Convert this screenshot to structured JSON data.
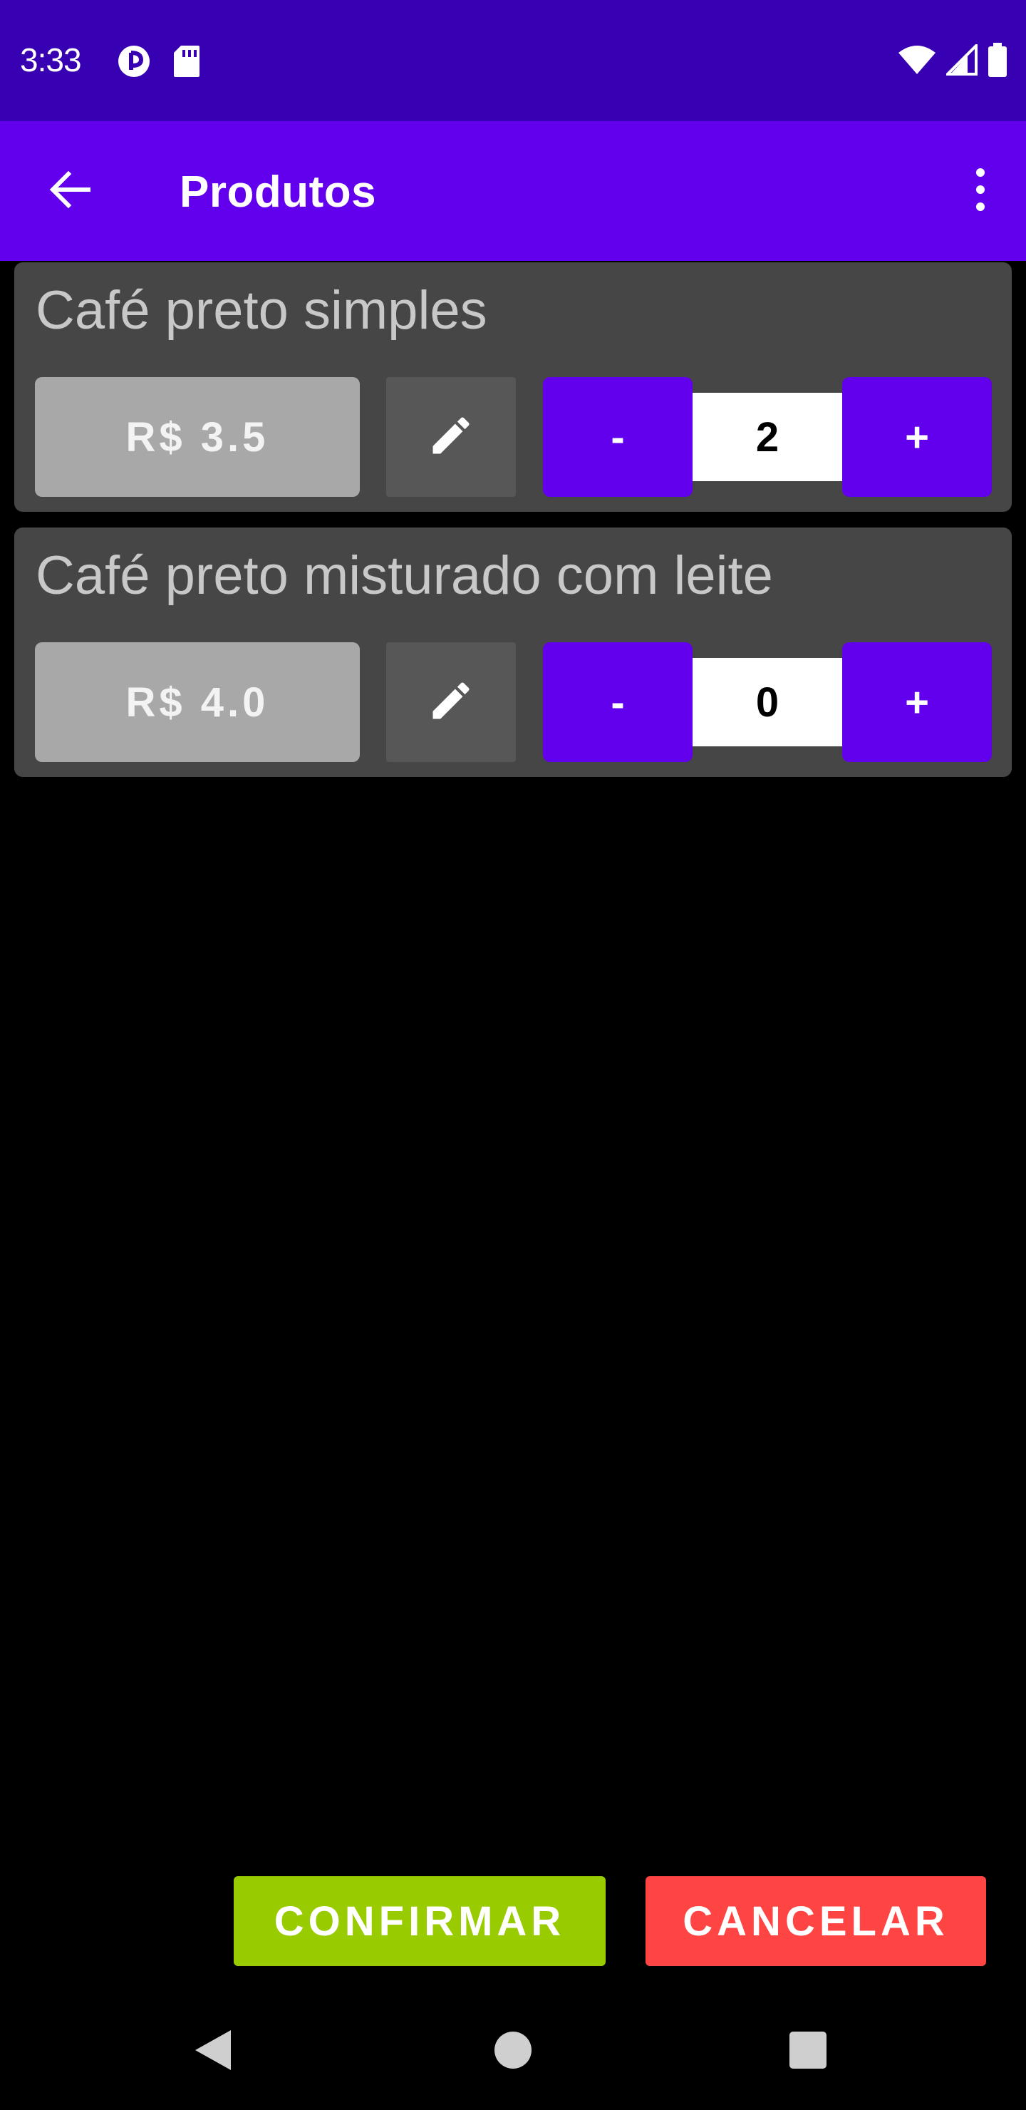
{
  "status_bar": {
    "time": "3:33",
    "icons_left": [
      "notification-app-icon",
      "sd-card-icon"
    ],
    "icons_right": [
      "wifi-icon",
      "cellular-signal-icon",
      "battery-icon"
    ]
  },
  "app_bar": {
    "title": "Produtos",
    "back_icon": "arrow-back-icon",
    "menu_icon": "more-vert-icon"
  },
  "products": [
    {
      "name": "Café preto simples",
      "price": "R$ 3.5",
      "minus": "-",
      "quantity": "2",
      "plus": "+"
    },
    {
      "name": "Café preto misturado com leite",
      "price": "R$ 4.0",
      "minus": "-",
      "quantity": "0",
      "plus": "+"
    }
  ],
  "actions": {
    "confirm": "CONFIRMAR",
    "cancel": "CANCELAR"
  },
  "colors": {
    "status_bar": "#3700b3",
    "app_bar": "#6200ee",
    "card": "#464646",
    "price_button": "#a8a8a8",
    "quantity_button": "#6200ee",
    "confirm": "#99cc00",
    "cancel": "#ff4444"
  },
  "nav_bar": {
    "icons": [
      "nav-back-icon",
      "nav-home-icon",
      "nav-recents-icon"
    ]
  }
}
